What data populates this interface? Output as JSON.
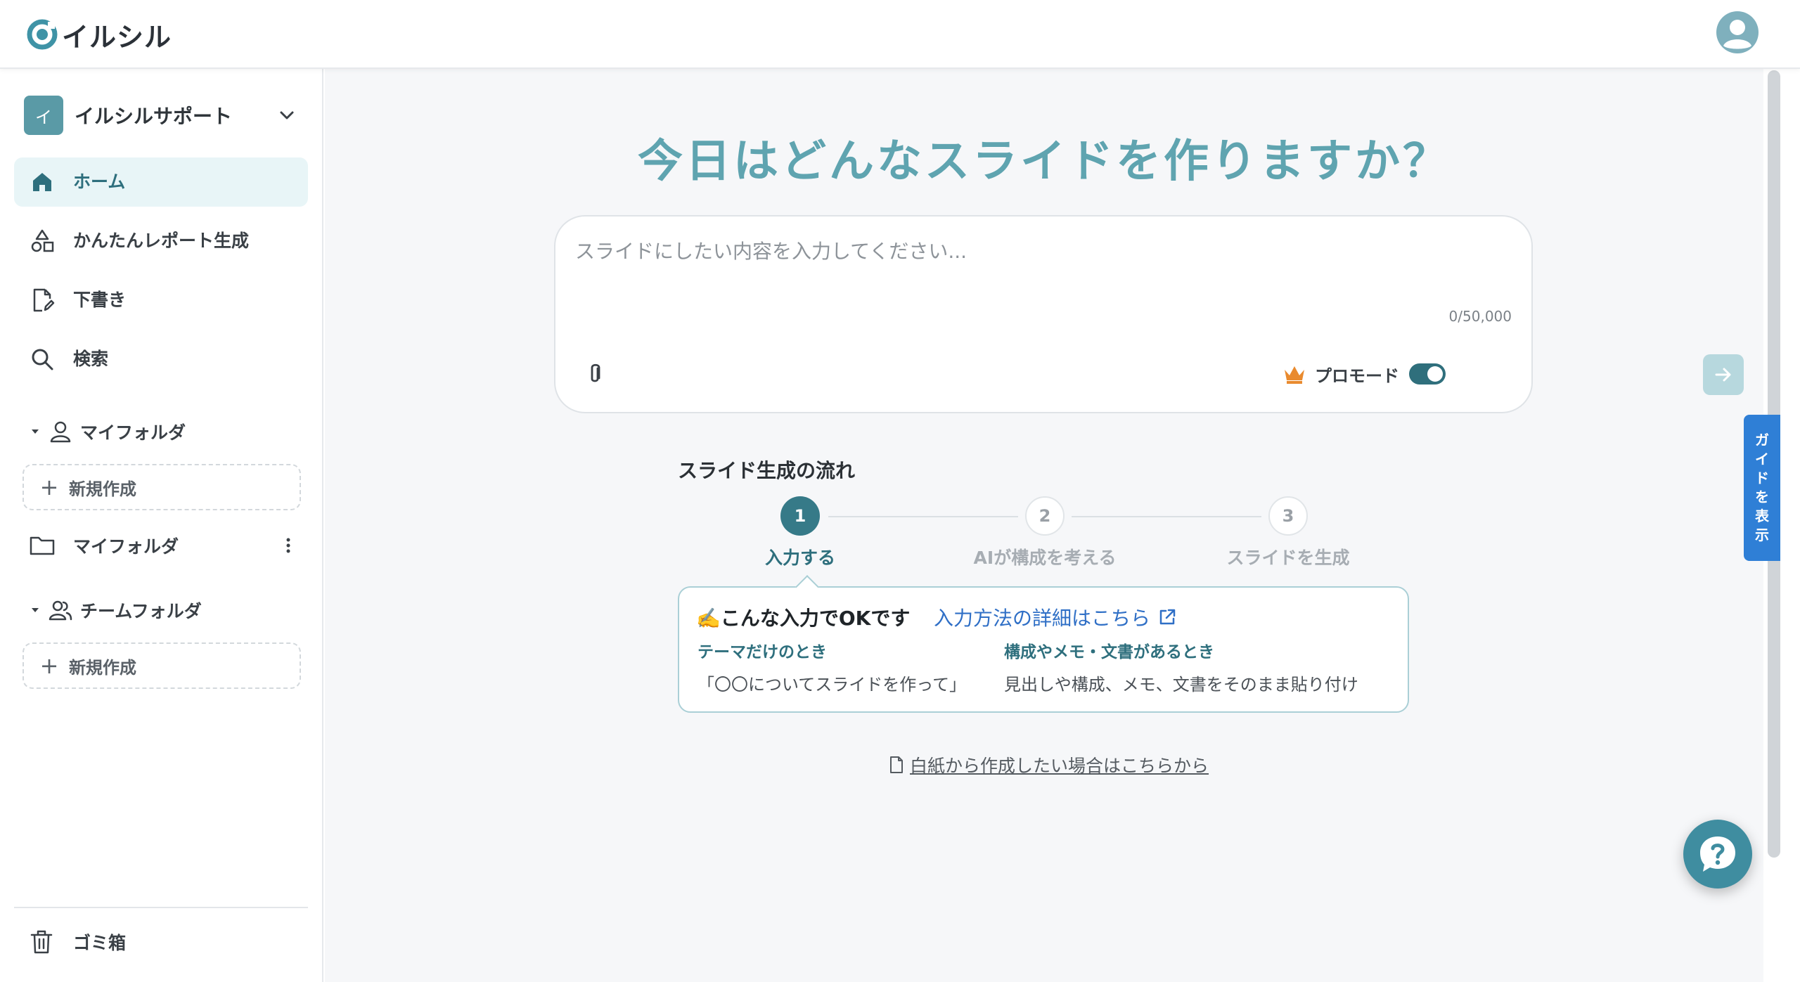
{
  "app": {
    "name": "イルシル"
  },
  "workspace": {
    "initial": "イ",
    "name": "イルシルサポート"
  },
  "nav": {
    "home": "ホーム",
    "report": "かんたんレポート生成",
    "drafts": "下書き",
    "search": "検索"
  },
  "sections": {
    "my_folder": "マイフォルダ",
    "team_folder": "チームフォルダ",
    "new_label": "新規作成",
    "my_folder_item": "マイフォルダ"
  },
  "trash": "ゴミ箱",
  "main": {
    "headline": "今日はどんなスライドを作りますか？",
    "placeholder": "スライドにしたい内容を入力してください...",
    "counter": "0/50,000",
    "pro_mode": "プロモード",
    "pro_enabled": true
  },
  "flow": {
    "title": "スライド生成の流れ",
    "steps": [
      {
        "num": "1",
        "label": "入力する"
      },
      {
        "num": "2",
        "label": "AIが構成を考える"
      },
      {
        "num": "3",
        "label": "スライドを生成"
      }
    ]
  },
  "tip": {
    "title": "✍️こんな入力でOKです",
    "link": "入力方法の詳細はこちら",
    "col1_heading": "テーマだけのとき",
    "col1_text": "「〇〇についてスライドを作って」",
    "col2_heading": "構成やメモ・文書があるとき",
    "col2_text": "見出しや構成、メモ、文書をそのまま貼り付け"
  },
  "blank_link": "白紙から作成したい場合はこちらから",
  "guide_tab": [
    "ガ",
    "イ",
    "ド",
    "を",
    "表",
    "示"
  ],
  "colors": {
    "accent": "#5fa4b0",
    "primary": "#367a88",
    "link": "#2f6fc6",
    "guide": "#2f7fd6"
  }
}
